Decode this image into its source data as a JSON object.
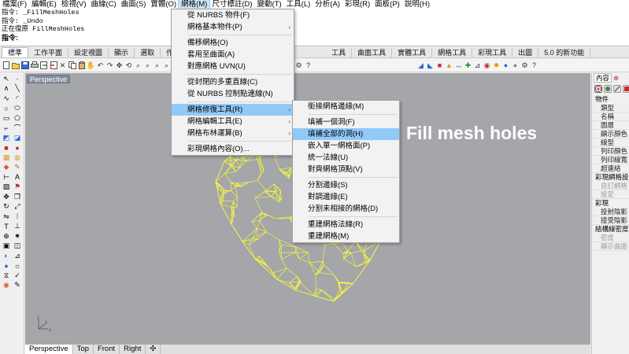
{
  "menubar": {
    "items": [
      "檔案(F)",
      "編輯(E)",
      "檢視(V)",
      "曲線(C)",
      "曲面(S)",
      "實體(O)",
      "網格(M)",
      "尺寸標註(D)",
      "變動(T)",
      "工具(L)",
      "分析(A)",
      "彩現(R)",
      "面板(P)",
      "說明(H)"
    ],
    "active_index": 6
  },
  "command_history": {
    "lines": [
      "指令: _FillMeshHoles",
      "指令: _Undo",
      "正在復原 FillMeshHoles"
    ],
    "prompt": "指令:"
  },
  "toolbar_tabs": {
    "left": [
      "標準",
      "工作平面",
      "設定視圖",
      "顯示",
      "選取",
      "作"
    ],
    "right": [
      "工具",
      "曲面工具",
      "實體工具",
      "網格工具",
      "彩現工具",
      "出圖",
      "5.0 的新功能"
    ]
  },
  "viewport": {
    "title": "Perspective",
    "tabs": [
      "Perspective",
      "Top",
      "Front",
      "Right",
      "✣"
    ],
    "background": "#a4a6a9",
    "mesh_color": "#ffff33",
    "axis_labels": {
      "x": "x",
      "y": "y",
      "z": "z"
    }
  },
  "mesh_menu": {
    "items": [
      {
        "label": "從 NURBS 物件(F)",
        "arrow": false
      },
      {
        "label": "網格基本物件(P)",
        "arrow": true
      },
      {
        "sep": true
      },
      {
        "label": "備移網格(O)",
        "arrow": false
      },
      {
        "label": "套用至曲面(A)",
        "arrow": false
      },
      {
        "label": "對應網格 UVN(U)",
        "arrow": false
      },
      {
        "sep": true
      },
      {
        "label": "從封閉的多重直線(C)",
        "arrow": false
      },
      {
        "label": "從 NURBS 控制點連線(N)",
        "arrow": false
      },
      {
        "sep": true
      },
      {
        "label": "網格修復工具(R)",
        "arrow": true,
        "highlighted": true
      },
      {
        "label": "網格編輯工具(E)",
        "arrow": true
      },
      {
        "label": "網格布林運算(B)",
        "arrow": true
      },
      {
        "sep": true
      },
      {
        "label": "彩現網格內容(O)...",
        "arrow": false
      }
    ]
  },
  "repair_submenu": {
    "items": [
      {
        "label": "銜接網格邊緣(M)"
      },
      {
        "sep": true
      },
      {
        "label": "填補一個洞(F)"
      },
      {
        "label": "填補全部的洞(H)",
        "highlighted": true
      },
      {
        "label": "嵌入單一網格面(P)"
      },
      {
        "label": "統一法線(U)"
      },
      {
        "label": "對齊網格頂點(V)"
      },
      {
        "sep": true
      },
      {
        "label": "分割邊緣(S)"
      },
      {
        "label": "對調邊緣(E)"
      },
      {
        "label": "分割未相接的網格(D)"
      },
      {
        "sep": true
      },
      {
        "label": "重建網格法線(R)"
      },
      {
        "label": "重建網格(M)"
      }
    ]
  },
  "annotation": {
    "text": "Fill mesh holes"
  },
  "right_panel": {
    "tabs": [
      "內容",
      "⊗"
    ],
    "object_section": "物件",
    "object_props": [
      "類型",
      "名稱",
      "圖層",
      "顯示顏色",
      "線型",
      "列印顏色",
      "列印線寬",
      "超連結"
    ],
    "render_mesh_section": "彩現網格設",
    "render_mesh_props": [
      "自訂網格",
      "設定"
    ],
    "render_section": "彩現",
    "render_props": [
      "投射陰影",
      "接受陰影"
    ],
    "density_section": "結構線密度",
    "density_props": [
      "密度",
      "顯示曲面"
    ]
  },
  "colors": {
    "menu_highlight": "#91c9f7",
    "menubar_active": "#cce4f7",
    "annotation": "#ffffff"
  }
}
